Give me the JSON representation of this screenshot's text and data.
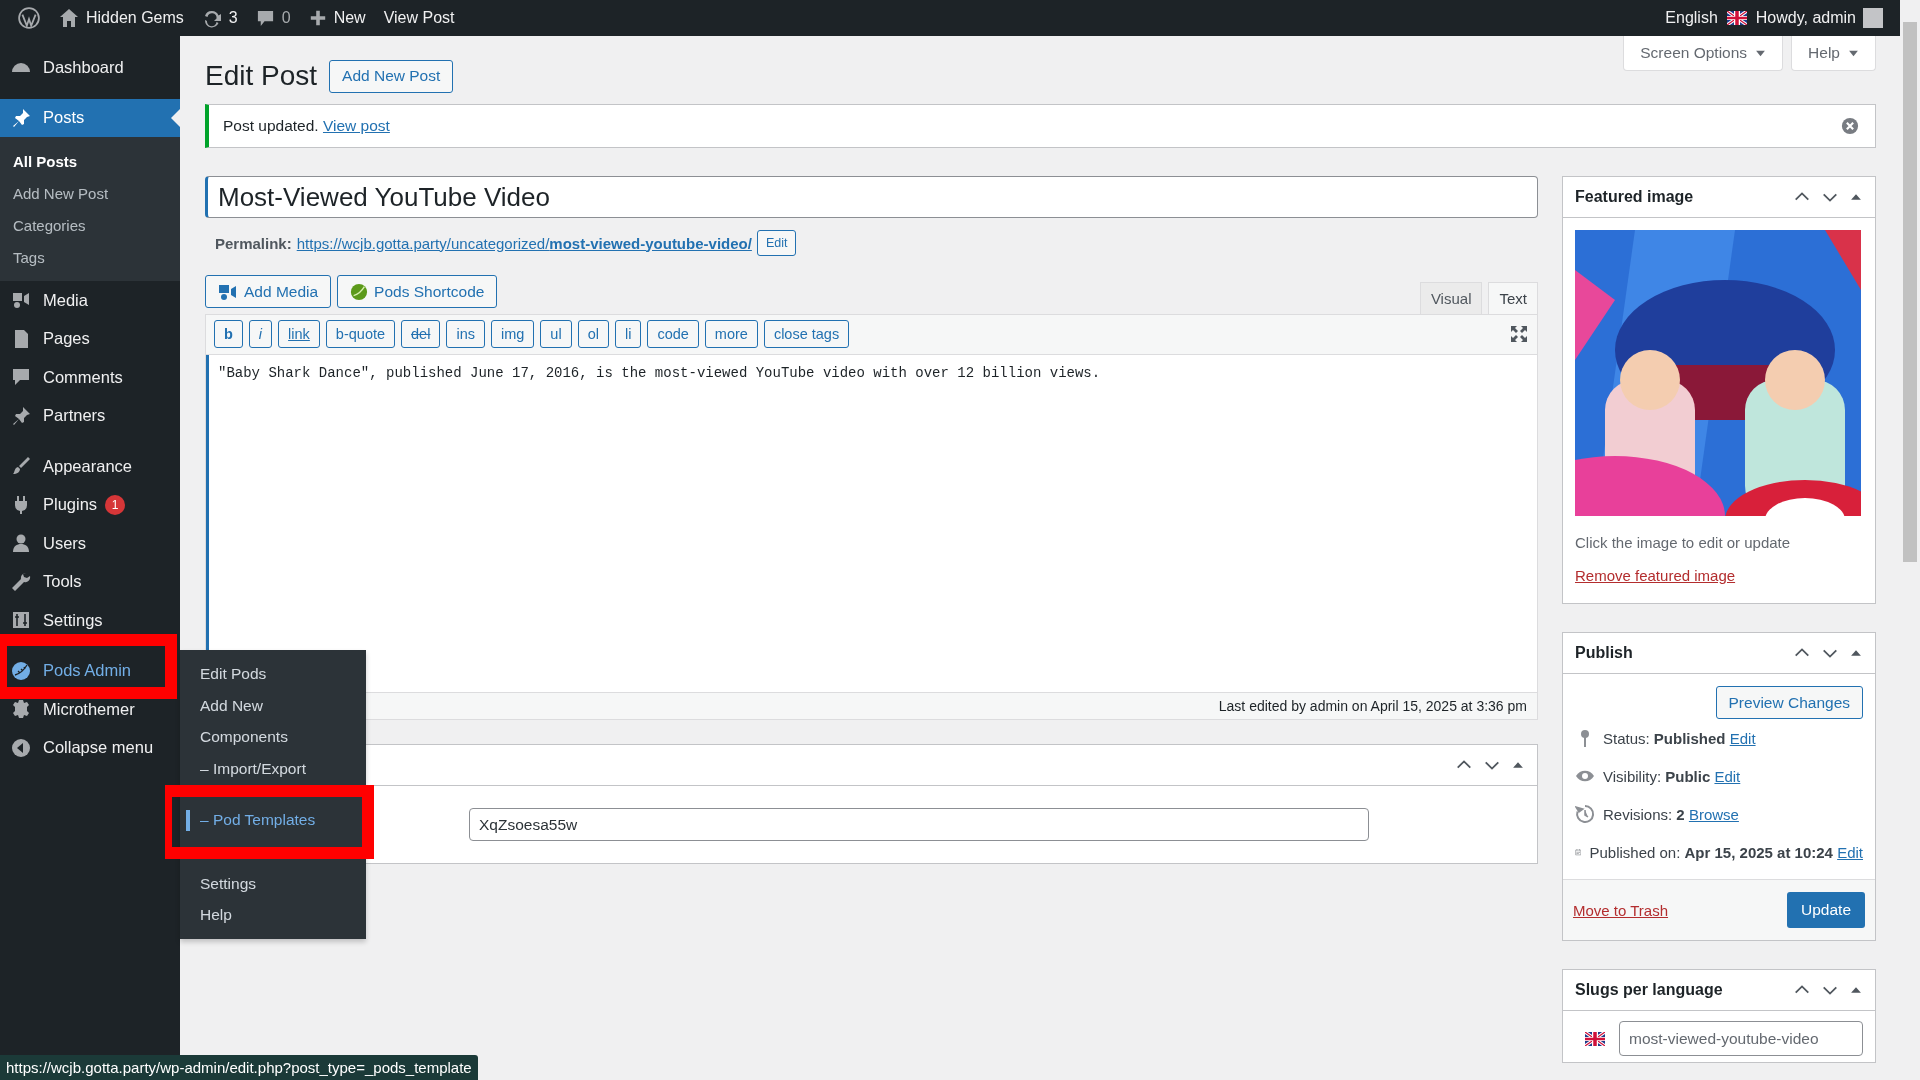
{
  "admin_bar": {
    "site": "Hidden Gems",
    "updates": "3",
    "comments": "0",
    "new": "New",
    "view": "View Post",
    "language": "English",
    "greeting": "Howdy, admin"
  },
  "sidebar": {
    "groups": [
      {
        "items": [
          {
            "label": "Dashboard",
            "kind": "dashboard",
            "current": false,
            "hovered": false,
            "highlighted": false
          }
        ]
      },
      {
        "items": [
          {
            "label": "Posts",
            "kind": "posts",
            "current": true,
            "hovered": false,
            "highlighted": false,
            "children": [
              {
                "label": "All Posts",
                "selected": true
              },
              {
                "label": "Add New Post",
                "selected": false
              },
              {
                "label": "Categories",
                "selected": false
              },
              {
                "label": "Tags",
                "selected": false
              }
            ]
          },
          {
            "label": "Media",
            "kind": "media",
            "current": false,
            "hovered": false,
            "highlighted": false
          },
          {
            "label": "Pages",
            "kind": "pages",
            "current": false,
            "hovered": false,
            "highlighted": false
          },
          {
            "label": "Comments",
            "kind": "comments",
            "current": false,
            "hovered": false,
            "highlighted": false
          },
          {
            "label": "Partners",
            "kind": "posts",
            "current": false,
            "hovered": false,
            "highlighted": false
          }
        ]
      },
      {
        "items": [
          {
            "label": "Appearance",
            "kind": "appearance",
            "current": false,
            "hovered": false,
            "highlighted": false
          },
          {
            "label": "Plugins",
            "kind": "plugins",
            "current": false,
            "hovered": false,
            "highlighted": false,
            "badge": "1"
          },
          {
            "label": "Users",
            "kind": "users",
            "current": false,
            "hovered": false,
            "highlighted": false
          },
          {
            "label": "Tools",
            "kind": "tools",
            "current": false,
            "hovered": false,
            "highlighted": false
          },
          {
            "label": "Settings",
            "kind": "settings",
            "current": false,
            "hovered": false,
            "highlighted": false
          }
        ]
      },
      {
        "items": [
          {
            "label": "Pods Admin",
            "kind": "pods",
            "current": false,
            "hovered": true,
            "highlighted": true
          },
          {
            "label": "Microthemer",
            "kind": "gear",
            "current": false,
            "hovered": false,
            "highlighted": false
          },
          {
            "label": "Collapse menu",
            "kind": "collapse",
            "current": false,
            "hovered": false,
            "highlighted": false
          }
        ]
      }
    ]
  },
  "flyout": {
    "items": [
      {
        "label": "Edit Pods",
        "selected": false,
        "highlighted": false
      },
      {
        "label": "Add New",
        "selected": false,
        "highlighted": false
      },
      {
        "label": "Components",
        "selected": false,
        "highlighted": false
      },
      {
        "label": "– Import/Export",
        "selected": false,
        "highlighted": false
      },
      {
        "label": "– Pod Templates",
        "selected": true,
        "highlighted": true
      },
      {
        "label": "Settings",
        "selected": false,
        "highlighted": false
      },
      {
        "label": "Help",
        "selected": false,
        "highlighted": false
      }
    ]
  },
  "screen_meta": [
    "Screen Options",
    "Help"
  ],
  "heading": "Edit Post",
  "add_new": "Add New Post",
  "notice": {
    "text": "Post updated.",
    "link": "View post"
  },
  "post_title": "Most-Viewed YouTube Video",
  "permalink": {
    "label": "Permalink:",
    "url": "https://wcjb.gotta.party/uncategorized/**most-viewed-youtube-video/**",
    "edit": "Edit"
  },
  "media_buttons": [
    {
      "label": "Add Media",
      "kind": "media"
    },
    {
      "label": "Pods Shortcode",
      "kind": "pods"
    }
  ],
  "editor_tabs": [
    {
      "label": "Visual",
      "selected": false
    },
    {
      "label": "Text",
      "selected": true
    }
  ],
  "quicktags": [
    {
      "label": "b",
      "kind": "bold"
    },
    {
      "label": "i",
      "kind": "italic"
    },
    {
      "label": "link",
      "kind": "underline"
    },
    {
      "label": "b-quote",
      "kind": "plain"
    },
    {
      "label": "del",
      "kind": "strike"
    },
    {
      "label": "ins",
      "kind": "plain"
    },
    {
      "label": "img",
      "kind": "plain"
    },
    {
      "label": "ul",
      "kind": "plain"
    },
    {
      "label": "ol",
      "kind": "plain"
    },
    {
      "label": "li",
      "kind": "plain"
    },
    {
      "label": "code",
      "kind": "plain"
    },
    {
      "label": "more",
      "kind": "plain"
    },
    {
      "label": "close tags",
      "kind": "plain"
    }
  ],
  "content": "\"Baby Shark Dance\", published June 17, 2016, is the most-viewed YouTube video with over 12 billion views.",
  "editor_status": "Last edited by admin on April 15, 2025 at 3:36 pm",
  "meta_box": {
    "field_value": "XqZsoesa55w"
  },
  "featured_image": {
    "title": "Featured image",
    "hint": "Click the image to edit or update",
    "remove": "Remove featured image"
  },
  "publish": {
    "title": "Publish",
    "preview": "Preview Changes",
    "rows": [
      {
        "kind": "status",
        "label": "Status:",
        "value": "Published",
        "link": "Edit"
      },
      {
        "kind": "visibility",
        "label": "Visibility:",
        "value": "Public",
        "link": "Edit"
      },
      {
        "kind": "revisions",
        "label": "Revisions:",
        "value": "2",
        "link": "Browse"
      },
      {
        "kind": "published",
        "label": "Published on:",
        "value": "Apr 15, 2025 at 10:24",
        "link": "Edit"
      }
    ],
    "trash": "Move to Trash",
    "update": "Update"
  },
  "slugs": {
    "title": "Slugs per language",
    "fields": [
      {
        "value": "most-viewed-youtube-video"
      }
    ]
  },
  "status_url": "https://wcjb.gotta.party/wp-admin/edit.php?post_type=_pods_template"
}
